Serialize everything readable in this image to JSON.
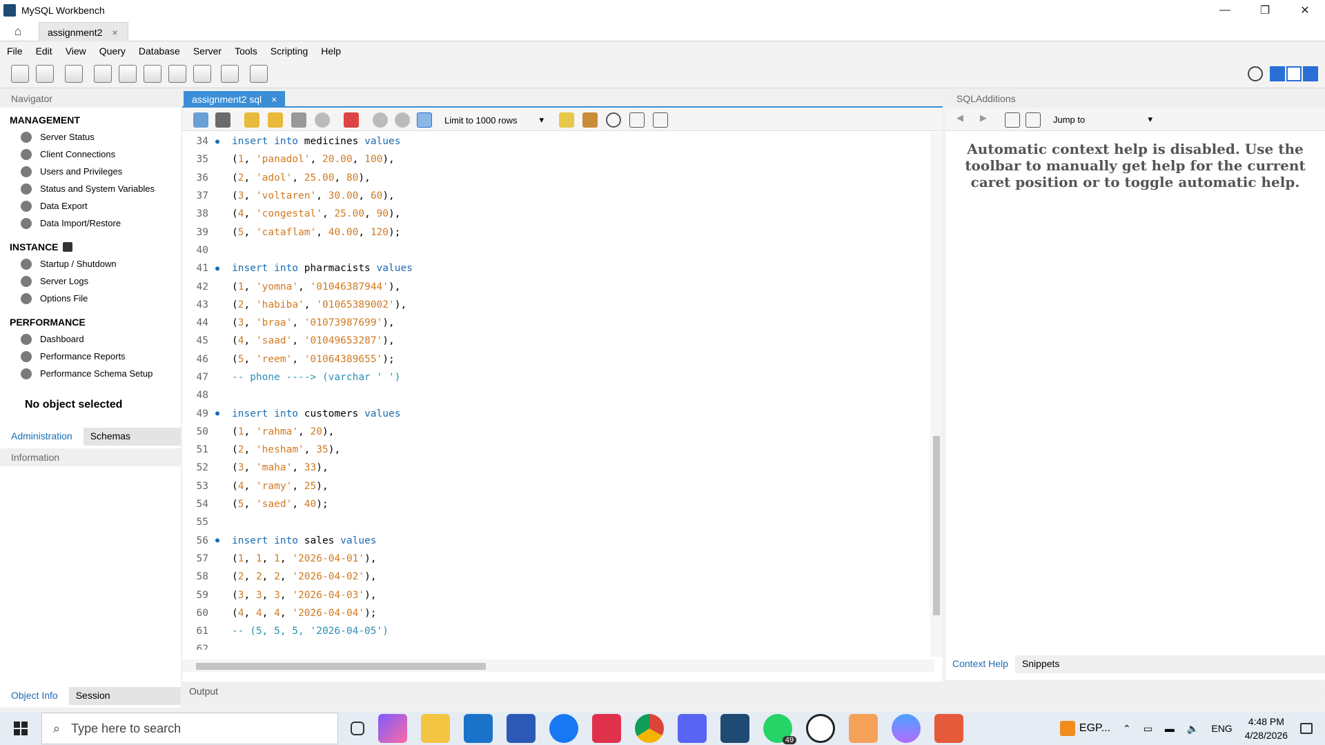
{
  "window": {
    "title": "MySQL Workbench",
    "controls": {
      "minimize": "—",
      "restore": "❐",
      "close": "✕"
    }
  },
  "connection_tab": {
    "label": "assignment2",
    "close": "×"
  },
  "menu": [
    "File",
    "Edit",
    "View",
    "Query",
    "Database",
    "Server",
    "Tools",
    "Scripting",
    "Help"
  ],
  "navigator": {
    "header": "Navigator",
    "management_title": "MANAGEMENT",
    "management": [
      "Server Status",
      "Client Connections",
      "Users and Privileges",
      "Status and System Variables",
      "Data Export",
      "Data Import/Restore"
    ],
    "instance_title": "INSTANCE",
    "instance": [
      "Startup / Shutdown",
      "Server Logs",
      "Options File"
    ],
    "performance_title": "PERFORMANCE",
    "performance": [
      "Dashboard",
      "Performance Reports",
      "Performance Schema Setup"
    ],
    "tabs": {
      "administration": "Administration",
      "schemas": "Schemas"
    },
    "info_header": "Information",
    "no_object": "No object selected",
    "bottom_tabs": {
      "object_info": "Object Info",
      "session": "Session"
    }
  },
  "editor": {
    "tab_label": "assignment2 sql",
    "tab_close": "×",
    "limit_select": "Limit to 1000 rows",
    "output_label": "Output"
  },
  "sql_additions": {
    "header": "SQLAdditions",
    "jump_to": "Jump to",
    "help_text": "Automatic context help is disabled. Use the toolbar to manually get help for the current caret position or to toggle automatic help.",
    "tabs": {
      "context_help": "Context Help",
      "snippets": "Snippets"
    }
  },
  "taskbar": {
    "search_placeholder": "Type here to search",
    "whatsapp_badge": "49",
    "egp": "EGP...",
    "lang": "ENG",
    "time": "4:48 PM",
    "date": "4/28/2026"
  }
}
